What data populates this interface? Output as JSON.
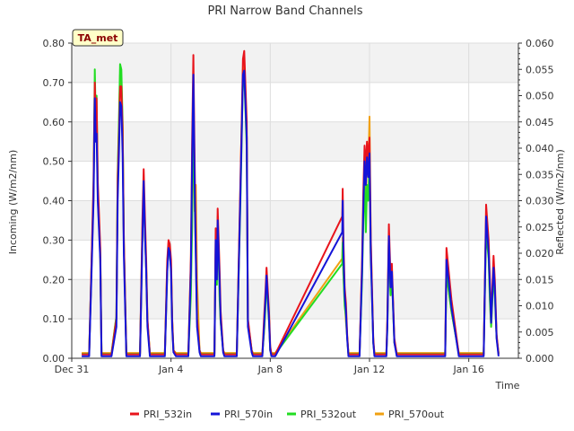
{
  "chart_data": {
    "type": "line",
    "title": "PRI Narrow Band Channels",
    "xlabel": "Time",
    "ylabel_left": "Incoming (W/m2/nm)",
    "ylabel_right": "Reflected (W/m2/nm)",
    "badge": "TA_met",
    "xlim": [
      0,
      18
    ],
    "ylim_left": [
      0,
      0.8
    ],
    "ylim_right": [
      0,
      0.06
    ],
    "x_ticks": [
      {
        "x": 0,
        "label": "Dec 31"
      },
      {
        "x": 4,
        "label": "Jan 4"
      },
      {
        "x": 8,
        "label": "Jan 8"
      },
      {
        "x": 12,
        "label": "Jan 12"
      },
      {
        "x": 16,
        "label": "Jan 16"
      }
    ],
    "y_ticks_left": [
      "0.00",
      "0.10",
      "0.20",
      "0.30",
      "0.40",
      "0.50",
      "0.60",
      "0.70",
      "0.80"
    ],
    "y_ticks_right": [
      "0.000",
      "0.005",
      "0.010",
      "0.015",
      "0.020",
      "0.025",
      "0.030",
      "0.035",
      "0.040",
      "0.045",
      "0.050",
      "0.055",
      "0.060"
    ],
    "grid": true,
    "legend_position": "bottom",
    "series": [
      {
        "name": "PRI_532in",
        "color": "#e8141c",
        "axis": "left",
        "x": [
          0.4,
          0.7,
          0.8,
          0.88,
          0.93,
          0.97,
          1.0,
          1.05,
          1.15,
          1.2,
          1.35,
          1.5,
          1.6,
          1.8,
          1.85,
          1.9,
          1.95,
          2.0,
          2.05,
          2.1,
          2.2,
          2.3,
          2.4,
          2.75,
          2.85,
          2.9,
          2.95,
          3.0,
          3.05,
          3.15,
          3.2,
          3.3,
          3.4,
          3.75,
          3.85,
          3.9,
          3.95,
          4.0,
          4.05,
          4.1,
          4.2,
          4.3,
          4.7,
          4.8,
          4.85,
          4.9,
          4.95,
          5.0,
          5.05,
          5.15,
          5.2,
          5.4,
          5.6,
          5.65,
          5.75,
          5.8,
          5.85,
          5.88,
          5.92,
          5.96,
          6.0,
          6.1,
          6.15,
          6.25,
          6.3,
          6.55,
          6.65,
          6.8,
          6.85,
          6.9,
          6.95,
          7.05,
          7.1,
          7.25,
          7.3,
          7.6,
          7.68,
          7.75,
          7.8,
          7.85,
          7.95,
          8.0,
          8.05,
          8.2,
          10.9,
          10.92,
          10.95,
          11.0,
          11.05,
          11.1,
          11.15,
          11.3,
          11.5,
          11.6,
          11.7,
          11.75,
          11.8,
          11.85,
          11.9,
          11.95,
          12.0,
          12.05,
          12.15,
          12.2,
          12.5,
          12.6,
          12.65,
          12.68,
          12.72,
          12.78,
          12.85,
          12.9,
          13.0,
          13.1,
          13.5,
          15.05,
          15.1,
          15.3,
          15.6,
          16.55,
          16.6,
          16.7,
          16.8,
          16.85,
          16.9,
          17.0,
          17.05,
          17.12,
          17.2
        ],
        "y": [
          0.01,
          0.01,
          0.25,
          0.45,
          0.7,
          0.6,
          0.66,
          0.45,
          0.28,
          0.01,
          0.01,
          0.01,
          0.01,
          0.1,
          0.45,
          0.56,
          0.69,
          0.69,
          0.58,
          0.3,
          0.01,
          0.01,
          0.01,
          0.01,
          0.35,
          0.48,
          0.36,
          0.25,
          0.1,
          0.01,
          0.01,
          0.01,
          0.01,
          0.01,
          0.25,
          0.3,
          0.29,
          0.25,
          0.1,
          0.02,
          0.01,
          0.01,
          0.01,
          0.25,
          0.55,
          0.77,
          0.5,
          0.3,
          0.1,
          0.02,
          0.01,
          0.01,
          0.01,
          0.01,
          0.01,
          0.33,
          0.22,
          0.38,
          0.3,
          0.22,
          0.12,
          0.02,
          0.01,
          0.01,
          0.01,
          0.01,
          0.01,
          0.45,
          0.6,
          0.76,
          0.78,
          0.6,
          0.1,
          0.02,
          0.01,
          0.01,
          0.01,
          0.1,
          0.16,
          0.23,
          0.12,
          0.03,
          0.01,
          0.01,
          0.36,
          0.43,
          0.3,
          0.18,
          0.14,
          0.06,
          0.01,
          0.01,
          0.01,
          0.01,
          0.25,
          0.42,
          0.54,
          0.48,
          0.55,
          0.5,
          0.56,
          0.3,
          0.05,
          0.01,
          0.01,
          0.01,
          0.01,
          0.01,
          0.1,
          0.34,
          0.2,
          0.24,
          0.05,
          0.01,
          0.01,
          0.01,
          0.28,
          0.15,
          0.01,
          0.01,
          0.01,
          0.39,
          0.3,
          0.2,
          0.1,
          0.26,
          0.2,
          0.06,
          0.01
        ]
      },
      {
        "name": "PRI_570in",
        "color": "#1414d8",
        "axis": "left",
        "x": [
          0.4,
          0.7,
          0.8,
          0.88,
          0.93,
          0.97,
          1.0,
          1.05,
          1.15,
          1.2,
          1.35,
          1.5,
          1.6,
          1.8,
          1.85,
          1.9,
          1.95,
          2.0,
          2.05,
          2.1,
          2.2,
          2.3,
          2.4,
          2.75,
          2.85,
          2.9,
          2.95,
          3.0,
          3.05,
          3.15,
          3.2,
          3.3,
          3.4,
          3.75,
          3.85,
          3.9,
          3.95,
          4.0,
          4.05,
          4.1,
          4.2,
          4.3,
          4.7,
          4.8,
          4.85,
          4.9,
          4.95,
          5.0,
          5.05,
          5.15,
          5.2,
          5.4,
          5.6,
          5.65,
          5.75,
          5.8,
          5.85,
          5.88,
          5.92,
          5.96,
          6.0,
          6.1,
          6.15,
          6.25,
          6.3,
          6.55,
          6.65,
          6.8,
          6.85,
          6.9,
          6.95,
          7.05,
          7.1,
          7.25,
          7.3,
          7.6,
          7.68,
          7.75,
          7.8,
          7.85,
          7.95,
          8.0,
          8.05,
          8.2,
          10.9,
          10.92,
          10.95,
          11.0,
          11.05,
          11.1,
          11.15,
          11.3,
          11.5,
          11.6,
          11.7,
          11.75,
          11.8,
          11.85,
          11.9,
          11.95,
          12.0,
          12.05,
          12.15,
          12.2,
          12.5,
          12.6,
          12.65,
          12.68,
          12.72,
          12.78,
          12.85,
          12.9,
          13.0,
          13.1,
          13.5,
          15.05,
          15.1,
          15.3,
          15.6,
          16.55,
          16.6,
          16.7,
          16.8,
          16.85,
          16.9,
          17.0,
          17.05,
          17.12,
          17.2
        ],
        "y": [
          0.005,
          0.005,
          0.22,
          0.4,
          0.66,
          0.55,
          0.57,
          0.4,
          0.25,
          0.005,
          0.005,
          0.005,
          0.005,
          0.08,
          0.4,
          0.52,
          0.65,
          0.64,
          0.52,
          0.26,
          0.005,
          0.005,
          0.005,
          0.005,
          0.3,
          0.45,
          0.32,
          0.22,
          0.08,
          0.005,
          0.005,
          0.005,
          0.005,
          0.005,
          0.22,
          0.28,
          0.27,
          0.22,
          0.08,
          0.015,
          0.005,
          0.005,
          0.005,
          0.22,
          0.5,
          0.72,
          0.45,
          0.26,
          0.08,
          0.015,
          0.005,
          0.005,
          0.005,
          0.005,
          0.005,
          0.3,
          0.2,
          0.35,
          0.27,
          0.19,
          0.1,
          0.015,
          0.005,
          0.005,
          0.005,
          0.005,
          0.005,
          0.42,
          0.57,
          0.72,
          0.73,
          0.56,
          0.08,
          0.015,
          0.005,
          0.005,
          0.005,
          0.08,
          0.14,
          0.21,
          0.1,
          0.02,
          0.005,
          0.005,
          0.32,
          0.4,
          0.27,
          0.16,
          0.12,
          0.05,
          0.005,
          0.005,
          0.005,
          0.005,
          0.22,
          0.38,
          0.5,
          0.44,
          0.51,
          0.46,
          0.52,
          0.27,
          0.04,
          0.005,
          0.005,
          0.005,
          0.005,
          0.005,
          0.08,
          0.31,
          0.18,
          0.22,
          0.04,
          0.005,
          0.005,
          0.005,
          0.25,
          0.13,
          0.005,
          0.005,
          0.005,
          0.36,
          0.27,
          0.18,
          0.09,
          0.23,
          0.18,
          0.05,
          0.005
        ]
      },
      {
        "name": "PRI_532out",
        "color": "#22dd22",
        "axis": "right",
        "x": [
          0.4,
          0.7,
          0.8,
          0.88,
          0.93,
          0.97,
          1.0,
          1.05,
          1.15,
          1.2,
          1.35,
          1.5,
          1.6,
          1.8,
          1.85,
          1.9,
          1.95,
          2.0,
          2.05,
          2.1,
          2.2,
          2.3,
          2.4,
          2.75,
          2.85,
          2.9,
          2.95,
          3.0,
          3.05,
          3.15,
          3.2,
          3.3,
          3.4,
          3.75,
          3.85,
          3.9,
          3.95,
          4.0,
          4.05,
          4.1,
          4.2,
          4.3,
          4.7,
          4.8,
          4.85,
          4.9,
          4.95,
          5.0,
          5.05,
          5.15,
          5.2,
          5.4,
          5.6,
          5.65,
          5.75,
          5.8,
          5.85,
          5.88,
          5.92,
          5.96,
          6.0,
          6.1,
          6.15,
          6.25,
          6.3,
          6.55,
          6.65,
          6.8,
          6.85,
          6.9,
          6.95,
          7.05,
          7.1,
          7.25,
          7.3,
          7.6,
          7.68,
          7.75,
          7.8,
          7.85,
          7.95,
          8.0,
          8.05,
          8.2,
          10.9,
          10.92,
          10.95,
          11.0,
          11.05,
          11.1,
          11.15,
          11.3,
          11.5,
          11.6,
          11.7,
          11.75,
          11.8,
          11.85,
          11.9,
          11.95,
          12.0,
          12.05,
          12.15,
          12.2,
          12.5,
          12.6,
          12.65,
          12.68,
          12.72,
          12.78,
          12.85,
          12.9,
          13.0,
          13.1,
          13.5,
          15.05,
          15.1,
          15.3,
          15.6,
          16.55,
          16.6,
          16.7,
          16.8,
          16.85,
          16.9,
          17.0,
          17.05,
          17.12,
          17.2
        ],
        "y": [
          0.0008,
          0.0008,
          0.018,
          0.032,
          0.055,
          0.045,
          0.05,
          0.032,
          0.02,
          0.0008,
          0.0008,
          0.0008,
          0.0008,
          0.008,
          0.035,
          0.045,
          0.056,
          0.055,
          0.045,
          0.022,
          0.0008,
          0.0008,
          0.0008,
          0.0008,
          0.024,
          0.033,
          0.024,
          0.017,
          0.007,
          0.0008,
          0.0008,
          0.0008,
          0.0008,
          0.0008,
          0.017,
          0.021,
          0.02,
          0.017,
          0.007,
          0.0015,
          0.0008,
          0.0008,
          0.0008,
          0.012,
          0.025,
          0.05,
          0.03,
          0.02,
          0.007,
          0.0015,
          0.0008,
          0.0008,
          0.0008,
          0.0008,
          0.0008,
          0.02,
          0.014,
          0.026,
          0.02,
          0.011,
          0.007,
          0.0015,
          0.0008,
          0.0008,
          0.0008,
          0.0008,
          0.0008,
          0.03,
          0.042,
          0.053,
          0.054,
          0.04,
          0.007,
          0.0015,
          0.0008,
          0.0008,
          0.0008,
          0.005,
          0.009,
          0.015,
          0.007,
          0.0015,
          0.0008,
          0.0008,
          0.018,
          0.022,
          0.016,
          0.01,
          0.008,
          0.004,
          0.0008,
          0.0008,
          0.0008,
          0.0008,
          0.015,
          0.026,
          0.035,
          0.024,
          0.033,
          0.03,
          0.038,
          0.02,
          0.003,
          0.0008,
          0.0008,
          0.0008,
          0.0008,
          0.0008,
          0.006,
          0.022,
          0.012,
          0.016,
          0.003,
          0.0008,
          0.0008,
          0.0008,
          0.016,
          0.009,
          0.0008,
          0.0008,
          0.0008,
          0.024,
          0.019,
          0.011,
          0.006,
          0.016,
          0.012,
          0.004,
          0.0008
        ]
      },
      {
        "name": "PRI_570out",
        "color": "#f0a012",
        "axis": "right",
        "x": [
          0.4,
          0.7,
          0.8,
          0.88,
          0.93,
          0.97,
          1.0,
          1.05,
          1.15,
          1.2,
          1.35,
          1.5,
          1.6,
          1.8,
          1.85,
          1.9,
          1.95,
          2.0,
          2.05,
          2.1,
          2.2,
          2.3,
          2.4,
          2.75,
          2.85,
          2.9,
          2.95,
          3.0,
          3.05,
          3.15,
          3.2,
          3.3,
          3.4,
          3.75,
          3.85,
          3.9,
          3.95,
          4.0,
          4.05,
          4.1,
          4.2,
          4.3,
          4.7,
          4.8,
          4.85,
          4.9,
          4.95,
          5.0,
          5.05,
          5.15,
          5.2,
          5.4,
          5.6,
          5.65,
          5.75,
          5.8,
          5.85,
          5.88,
          5.92,
          5.96,
          6.0,
          6.1,
          6.15,
          6.25,
          6.3,
          6.55,
          6.65,
          6.8,
          6.85,
          6.9,
          6.95,
          7.05,
          7.1,
          7.25,
          7.3,
          7.6,
          7.68,
          7.75,
          7.8,
          7.85,
          7.95,
          8.0,
          8.05,
          8.2,
          10.9,
          10.92,
          10.95,
          11.0,
          11.05,
          11.1,
          11.15,
          11.3,
          11.5,
          11.6,
          11.7,
          11.75,
          11.8,
          11.85,
          11.9,
          11.95,
          12.0,
          12.05,
          12.15,
          12.2,
          12.5,
          12.6,
          12.65,
          12.68,
          12.72,
          12.78,
          12.85,
          12.9,
          13.0,
          13.1,
          13.5,
          15.05,
          15.1,
          15.3,
          15.6,
          16.55,
          16.6,
          16.7,
          16.8,
          16.85,
          16.9,
          17.0,
          17.05,
          17.12,
          17.2
        ],
        "y": [
          0.001,
          0.001,
          0.018,
          0.031,
          0.05,
          0.042,
          0.048,
          0.031,
          0.019,
          0.001,
          0.001,
          0.001,
          0.001,
          0.008,
          0.034,
          0.044,
          0.054,
          0.053,
          0.044,
          0.022,
          0.001,
          0.001,
          0.001,
          0.001,
          0.024,
          0.033,
          0.024,
          0.017,
          0.007,
          0.001,
          0.001,
          0.001,
          0.001,
          0.001,
          0.018,
          0.022,
          0.021,
          0.018,
          0.007,
          0.0015,
          0.001,
          0.001,
          0.001,
          0.018,
          0.03,
          0.045,
          0.028,
          0.033,
          0.015,
          0.0015,
          0.001,
          0.001,
          0.001,
          0.001,
          0.001,
          0.021,
          0.015,
          0.027,
          0.021,
          0.012,
          0.007,
          0.0015,
          0.001,
          0.001,
          0.001,
          0.001,
          0.001,
          0.033,
          0.045,
          0.055,
          0.056,
          0.042,
          0.007,
          0.0015,
          0.001,
          0.001,
          0.001,
          0.005,
          0.01,
          0.016,
          0.008,
          0.0015,
          0.001,
          0.001,
          0.019,
          0.023,
          0.016,
          0.011,
          0.007,
          0.004,
          0.001,
          0.001,
          0.001,
          0.001,
          0.017,
          0.029,
          0.038,
          0.027,
          0.041,
          0.036,
          0.046,
          0.023,
          0.003,
          0.001,
          0.001,
          0.001,
          0.001,
          0.001,
          0.007,
          0.023,
          0.012,
          0.017,
          0.003,
          0.001,
          0.001,
          0.001,
          0.016,
          0.009,
          0.001,
          0.001,
          0.001,
          0.026,
          0.02,
          0.012,
          0.006,
          0.017,
          0.013,
          0.004,
          0.001
        ]
      }
    ]
  }
}
